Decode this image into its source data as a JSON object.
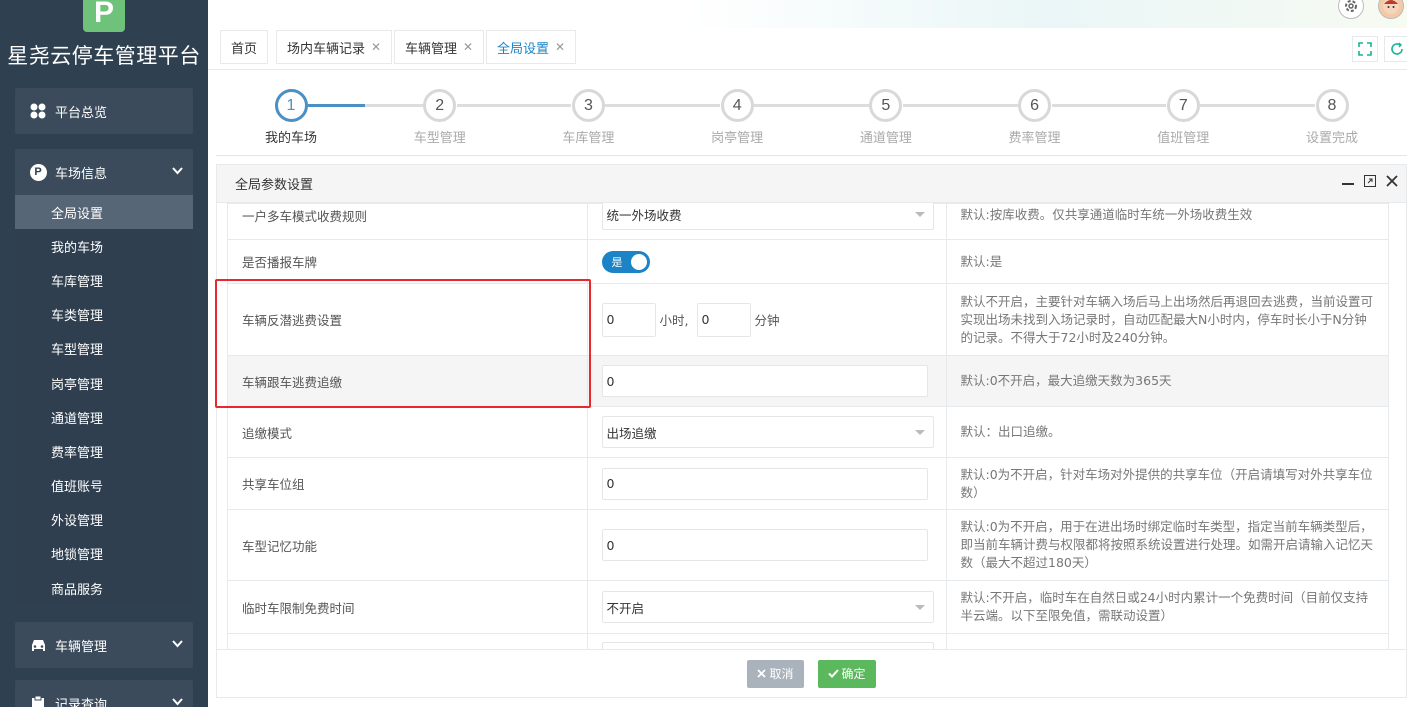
{
  "sidebar": {
    "logo_letter": "P",
    "brand": "星尧云停车管理平台",
    "overview": {
      "label": "平台总览",
      "icon": "grid-icon"
    },
    "parking_info": {
      "label": "车场信息",
      "icon": "parking-circle-icon",
      "items": [
        "全局设置",
        "我的车场",
        "车库管理",
        "车类管理",
        "车型管理",
        "岗亭管理",
        "通道管理",
        "费率管理",
        "值班账号",
        "外设管理",
        "地锁管理",
        "商品服务"
      ],
      "active_index": 0
    },
    "vehicle_mgmt": {
      "label": "车辆管理",
      "icon": "car-icon"
    },
    "record_query": {
      "label": "记录查询",
      "icon": "clipboard-icon"
    }
  },
  "tabs": [
    {
      "label": "首页",
      "closable": false
    },
    {
      "label": "场内车辆记录",
      "closable": true
    },
    {
      "label": "车辆管理",
      "closable": true
    },
    {
      "label": "全局设置",
      "closable": true,
      "active": true
    }
  ],
  "steps": [
    {
      "num": "1",
      "label": "我的车场",
      "active": true
    },
    {
      "num": "2",
      "label": "车型管理"
    },
    {
      "num": "3",
      "label": "车库管理"
    },
    {
      "num": "4",
      "label": "岗亭管理"
    },
    {
      "num": "5",
      "label": "通道管理"
    },
    {
      "num": "6",
      "label": "费率管理"
    },
    {
      "num": "7",
      "label": "值班管理"
    },
    {
      "num": "8",
      "label": "设置完成"
    }
  ],
  "panel": {
    "title": "全局参数设置",
    "rows": [
      {
        "label": "一户多车模式收费规则",
        "type": "select",
        "value": "统一外场收费",
        "desc": "默认:按库收费。仅共享通道临时车统一外场收费生效"
      },
      {
        "label": "是否播报车牌",
        "type": "toggle",
        "value": "是",
        "desc": "默认:是"
      },
      {
        "label": "车辆反潜逃费设置",
        "type": "dual",
        "hours": "0",
        "hours_unit": "小时,",
        "minutes": "0",
        "minutes_unit": "分钟",
        "desc": "默认不开启，主要针对车辆入场后马上出场然后再退回去逃费，当前设置可实现出场未找到入场记录时，自动匹配最大N小时内，停车时长小于N分钟的记录。不得大于72小时及240分钟。"
      },
      {
        "label": "车辆跟车逃费追缴",
        "type": "input",
        "value": "0",
        "desc": "默认:0不开启，最大追缴天数为365天"
      },
      {
        "label": "追缴模式",
        "type": "select",
        "value": "出场追缴",
        "desc": "默认：出口追缴。"
      },
      {
        "label": "共享车位组",
        "type": "input",
        "value": "0",
        "desc": "默认:0为不开启，针对车场对外提供的共享车位（开启请填写对外共享车位数）"
      },
      {
        "label": "车型记忆功能",
        "type": "input",
        "value": "0",
        "desc": "默认:0为不开启，用于在进出场时绑定临时车类型，指定当前车辆类型后，即当前车辆计费与权限都将按照系统设置进行处理。如需开启请输入记忆天数（最大不超过180天）"
      },
      {
        "label": "临时车限制免费时间",
        "type": "select",
        "value": "不开启",
        "desc": "默认:不开启，临时车在自然日或24小时内累计一个免费时间（目前仅支持半云端。以下至限免值，需联动设置）"
      }
    ],
    "cancel_label": "取消",
    "ok_label": "确定"
  }
}
